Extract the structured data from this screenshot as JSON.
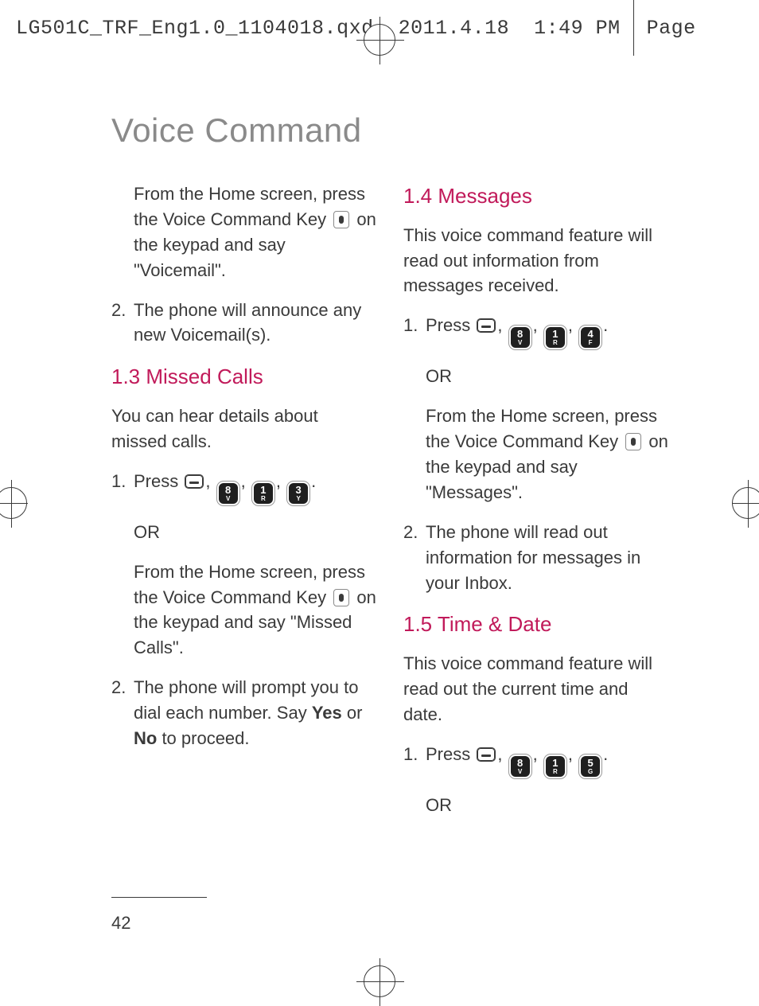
{
  "meta": {
    "filename": "LG501C_TRF_Eng1.0_1104018.qxd",
    "date": "2011.4.18",
    "time": "1:49 PM",
    "page_label": "Page"
  },
  "title": "Voice Command",
  "page_number": "42",
  "left": {
    "intro_1": "From the Home screen, press the Voice Command Key ",
    "intro_2": " on the keypad and say \"Voicemail\".",
    "step2_num": "2.",
    "step2": "The phone will announce any new Voicemail(s).",
    "sec13_title": "1.3 Missed Calls",
    "sec13_desc": "You can hear details about missed calls.",
    "sec13_step1_num": "1.",
    "sec13_step1_press": "Press ",
    "or": "OR",
    "sec13_alt_1": "From the Home screen, press the Voice Command Key ",
    "sec13_alt_2": " on the keypad and say \"Missed Calls\".",
    "sec13_step2_num": "2.",
    "sec13_step2_a": "The phone will prompt you to dial each number. Say ",
    "sec13_step2_yes": "Yes",
    "sec13_step2_b": " or ",
    "sec13_step2_no": "No",
    "sec13_step2_c": " to proceed."
  },
  "right": {
    "sec14_title": "1.4 Messages",
    "sec14_desc": "This voice command feature will read out information from messages received.",
    "sec14_step1_num": "1.",
    "sec14_step1_press": "Press ",
    "or": "OR",
    "sec14_alt_1": "From the Home screen, press the Voice Command Key ",
    "sec14_alt_2": " on the keypad and say \"Messages\".",
    "sec14_step2_num": "2.",
    "sec14_step2": "The phone will read out information for messages in your Inbox.",
    "sec15_title": "1.5 Time & Date",
    "sec15_desc": "This voice command feature will read out the current time and date.",
    "sec15_step1_num": "1.",
    "sec15_step1_press": "Press ",
    "or2": "OR"
  },
  "keys": {
    "missed": [
      {
        "digit": "8",
        "letter": "V"
      },
      {
        "digit": "1",
        "letter": "R"
      },
      {
        "digit": "3",
        "letter": "Y"
      }
    ],
    "messages": [
      {
        "digit": "8",
        "letter": "V"
      },
      {
        "digit": "1",
        "letter": "R"
      },
      {
        "digit": "4",
        "letter": "F"
      }
    ],
    "time": [
      {
        "digit": "8",
        "letter": "V"
      },
      {
        "digit": "1",
        "letter": "R"
      },
      {
        "digit": "5",
        "letter": "G"
      }
    ]
  },
  "punct": {
    "comma": ",",
    "period": "."
  }
}
